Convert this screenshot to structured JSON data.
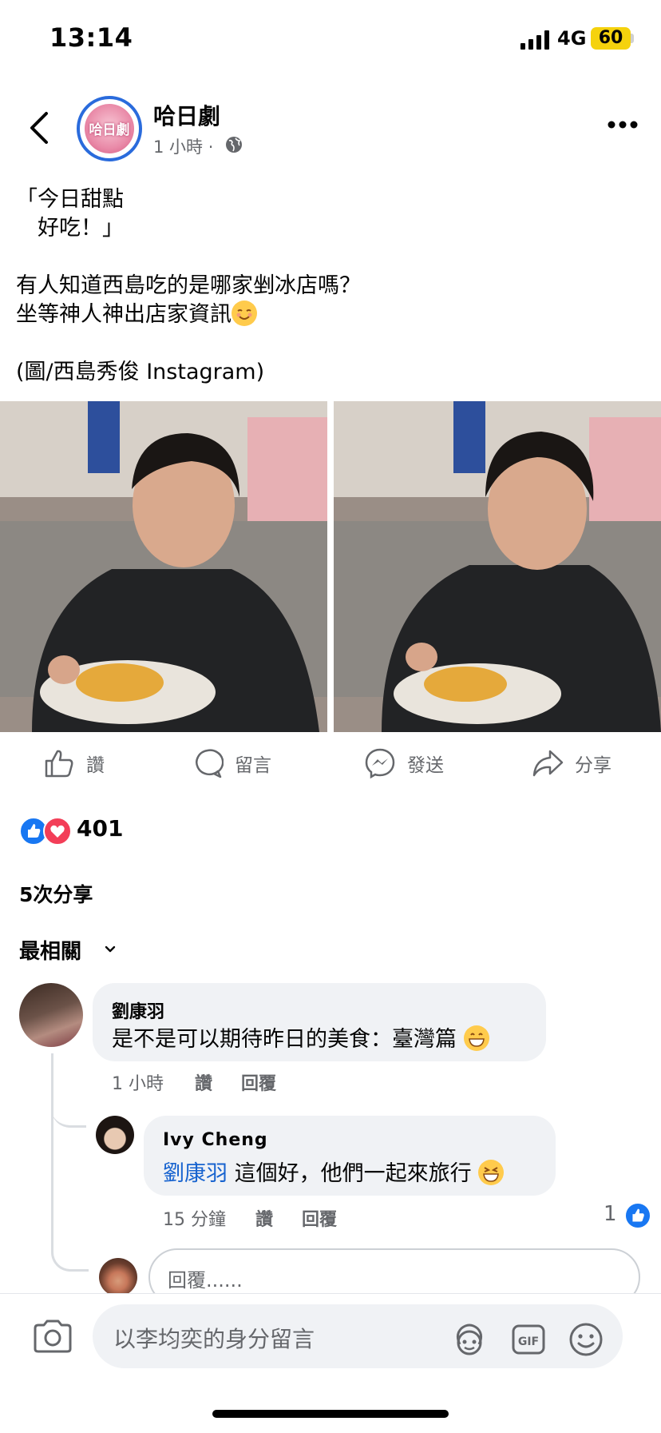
{
  "status_bar": {
    "time": "13:14",
    "network": "4G",
    "battery": "60"
  },
  "header": {
    "page_name": "哈日劇",
    "time": "1 小時 ·",
    "avatar_text": "哈日劇"
  },
  "post": {
    "text_line1": "「今日甜點",
    "text_line2": "　好吃！」",
    "text_line3": "有人知道西島吃的是哪家剉冰店嗎？",
    "text_line4": "坐等神人神出店家資訊",
    "text_line5": "(圖/西島秀俊 Instagram)"
  },
  "actions": {
    "like": "讚",
    "comment": "留言",
    "send": "發送",
    "share": "分享"
  },
  "reactions": {
    "count": "401"
  },
  "shares": "5次分享",
  "sort_label": "最相關",
  "comments": [
    {
      "name": "劉康羽",
      "text": "是不是可以期待昨日的美食：臺灣篇",
      "time": "1 小時",
      "like": "讚",
      "reply": "回覆"
    },
    {
      "name": "Ivy  Cheng",
      "mention": "劉康羽",
      "text": " 這個好，他們一起來旅行",
      "time": "15 分鐘",
      "like": "讚",
      "reply": "回覆",
      "likes": "1"
    }
  ],
  "reply_placeholder": "回覆......",
  "composer_placeholder": "以李均奕的身分留言",
  "icons": [
    "back-arrow-icon",
    "globe-icon",
    "more-icon",
    "like-icon",
    "comment-icon",
    "messenger-icon",
    "share-icon",
    "camera-icon",
    "avatar-sticker-icon",
    "gif-icon",
    "emoji-icon"
  ],
  "colors": {
    "accent": "#1877f2",
    "love": "#f33e58",
    "battery": "#f5d20d",
    "mention": "#1763cf"
  }
}
